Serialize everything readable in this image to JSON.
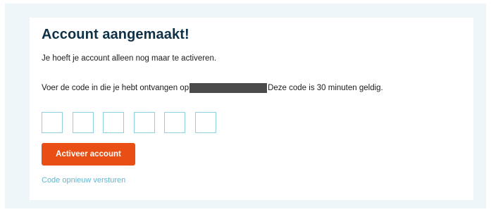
{
  "card": {
    "title": "Account aangemaakt!",
    "subtitle": "Je hoeft je account alleen nog maar te activeren.",
    "code_instruction_before": "Voer de code in die je hebt ontvangen op",
    "code_instruction_after": "Deze code is 30 minuten geldig."
  },
  "code_inputs": {
    "count": 6,
    "values": [
      "",
      "",
      "",
      "",
      "",
      ""
    ]
  },
  "actions": {
    "activate_label": "Activeer account",
    "resend_label": "Code opnieuw versturen"
  },
  "colors": {
    "accent": "#e94f14",
    "title": "#0e3147",
    "link": "#5fb7cf",
    "input_border": "#8fd0e0",
    "page_background": "#eff6f9"
  }
}
